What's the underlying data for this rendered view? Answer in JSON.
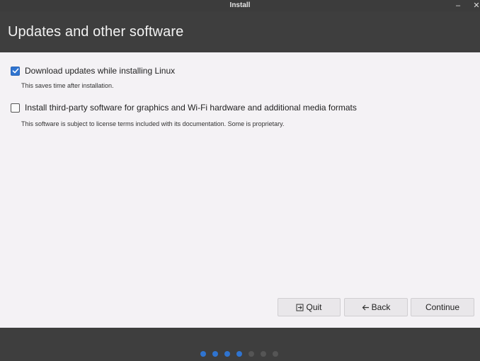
{
  "window": {
    "title": "Install",
    "minimize_icon": "minimize-icon",
    "close_icon": "close-icon"
  },
  "page": {
    "title": "Updates and other software"
  },
  "options": [
    {
      "label": "Download updates while installing Linux",
      "description": "This saves time after installation.",
      "checked": true
    },
    {
      "label": "Install third-party software for graphics and Wi-Fi hardware and additional media formats",
      "description": "This software is subject to license terms included with its documentation. Some is proprietary.",
      "checked": false
    }
  ],
  "buttons": {
    "quit_label": "Quit",
    "quit_icon": "exit-icon",
    "back_label": "Back",
    "back_icon": "arrow-left-icon",
    "continue_label": "Continue"
  },
  "progress": {
    "total_steps": 7,
    "completed_steps": 4,
    "active_color": "#2f74d0",
    "inactive_color": "#555555"
  },
  "colors": {
    "accent": "#2f74d0",
    "header_bg": "#3e3e3e",
    "content_bg": "#f4f2f5"
  }
}
